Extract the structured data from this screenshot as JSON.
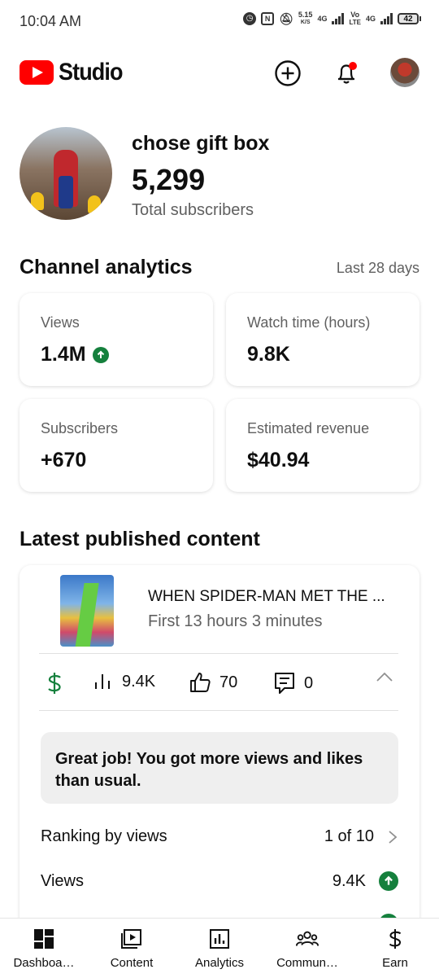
{
  "status_bar": {
    "time": "10:04 AM",
    "net_speed_value": "5.15",
    "net_speed_unit": "K/S",
    "network_1": "4G",
    "volte_top": "Vo",
    "volte_bottom": "LTE",
    "network_2": "4G",
    "battery": "42"
  },
  "header": {
    "logo_text": "Studio"
  },
  "channel": {
    "name": "chose gift box",
    "subscriber_count": "5,299",
    "subscriber_label": "Total subscribers"
  },
  "analytics": {
    "title": "Channel analytics",
    "period": "Last 28 days",
    "cards": [
      {
        "label": "Views",
        "value": "1.4M"
      },
      {
        "label": "Watch time (hours)",
        "value": "9.8K"
      },
      {
        "label": "Subscribers",
        "value": "+670"
      },
      {
        "label": "Estimated revenue",
        "value": "$40.94"
      }
    ]
  },
  "latest": {
    "title": "Latest published content",
    "video_title": "WHEN SPIDER-MAN MET THE ...",
    "video_subtitle": "First 13 hours 3 minutes",
    "stats": {
      "views": "9.4K",
      "likes": "70",
      "comments": "0"
    },
    "praise": "Great job! You got more views and likes than usual.",
    "ranking_label": "Ranking by views",
    "ranking_value": "1 of 10",
    "views_label": "Views",
    "views_value": "9.4K"
  },
  "bottom_nav": [
    {
      "label": "Dashboa…",
      "icon": "dashboard-icon"
    },
    {
      "label": "Content",
      "icon": "content-icon"
    },
    {
      "label": "Analytics",
      "icon": "analytics-icon"
    },
    {
      "label": "Commun…",
      "icon": "community-icon"
    },
    {
      "label": "Earn",
      "icon": "earn-icon"
    }
  ],
  "colors": {
    "brand_red": "#ff0000",
    "positive_green": "#15803d",
    "notification_dot": "#ff0000"
  }
}
